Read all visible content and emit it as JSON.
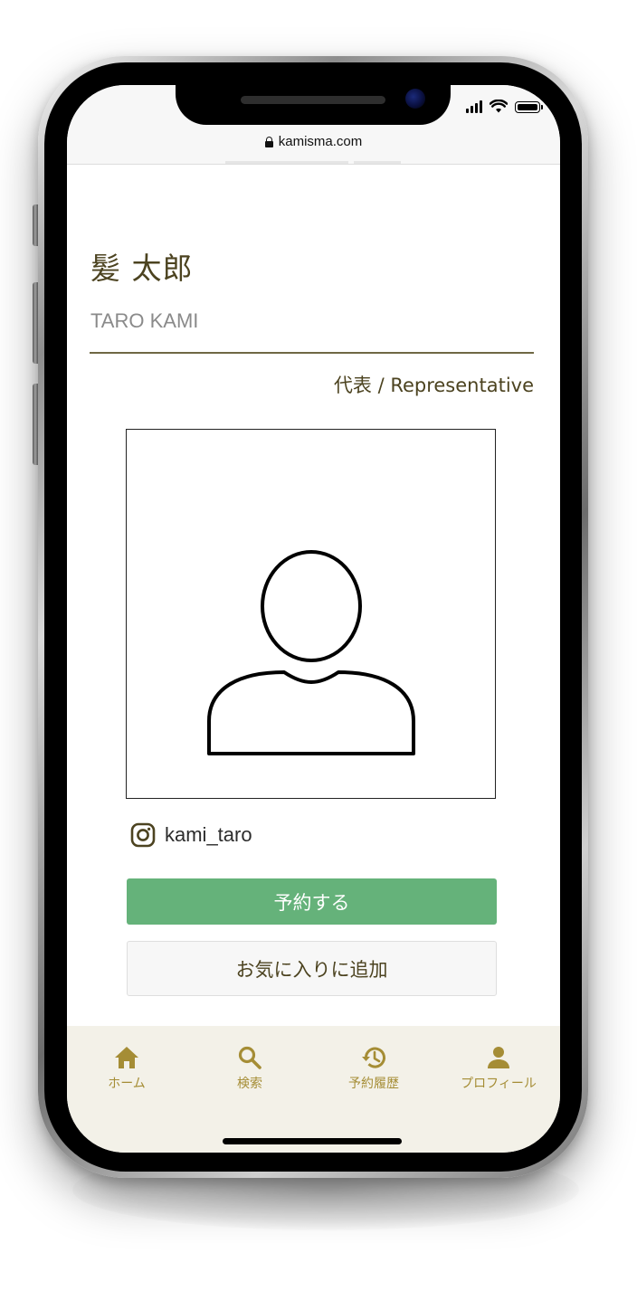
{
  "browser": {
    "url": "kamisma.com"
  },
  "profile": {
    "name_ja": "髪 太郎",
    "name_en": "TARO KAMI",
    "role": "代表 / Representative",
    "instagram_handle": "kami_taro"
  },
  "actions": {
    "reserve_label": "予約する",
    "favorite_label": "お気に入りに追加"
  },
  "bottom_nav": {
    "items": [
      {
        "label": "ホーム",
        "icon": "home-icon"
      },
      {
        "label": "検索",
        "icon": "search-icon"
      },
      {
        "label": "予約履歴",
        "icon": "history-icon"
      },
      {
        "label": "プロフィール",
        "icon": "person-icon"
      }
    ]
  },
  "colors": {
    "accent_gold": "#a58d35",
    "reserve_green": "#65b27a",
    "text_dark_olive": "#4c4320",
    "nav_background": "#f3f1e8"
  }
}
